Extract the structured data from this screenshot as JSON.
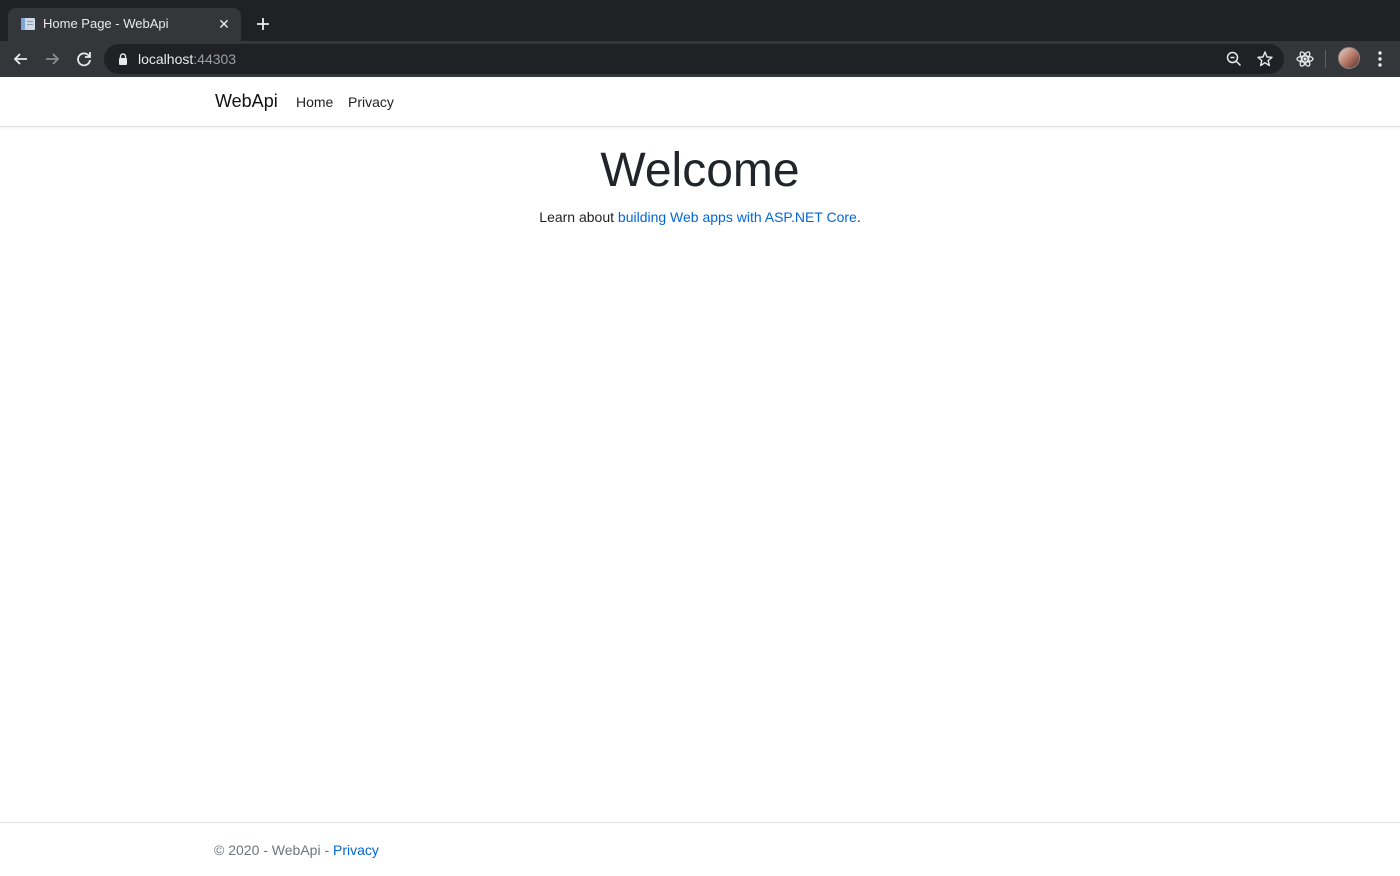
{
  "browser": {
    "tab_title": "Home Page - WebApi",
    "url_host": "localhost",
    "url_port": ":44303"
  },
  "navbar": {
    "brand": "WebApi",
    "links": [
      {
        "label": "Home"
      },
      {
        "label": "Privacy"
      }
    ]
  },
  "main": {
    "heading": "Welcome",
    "lead_prefix": "Learn about ",
    "lead_link": "building Web apps with ASP.NET Core",
    "lead_suffix": "."
  },
  "footer": {
    "copyright": "© 2020 - WebApi - ",
    "privacy_link": "Privacy"
  },
  "colors": {
    "link": "#0366d6",
    "chrome_dark": "#202124",
    "chrome_tab": "#35363a"
  }
}
